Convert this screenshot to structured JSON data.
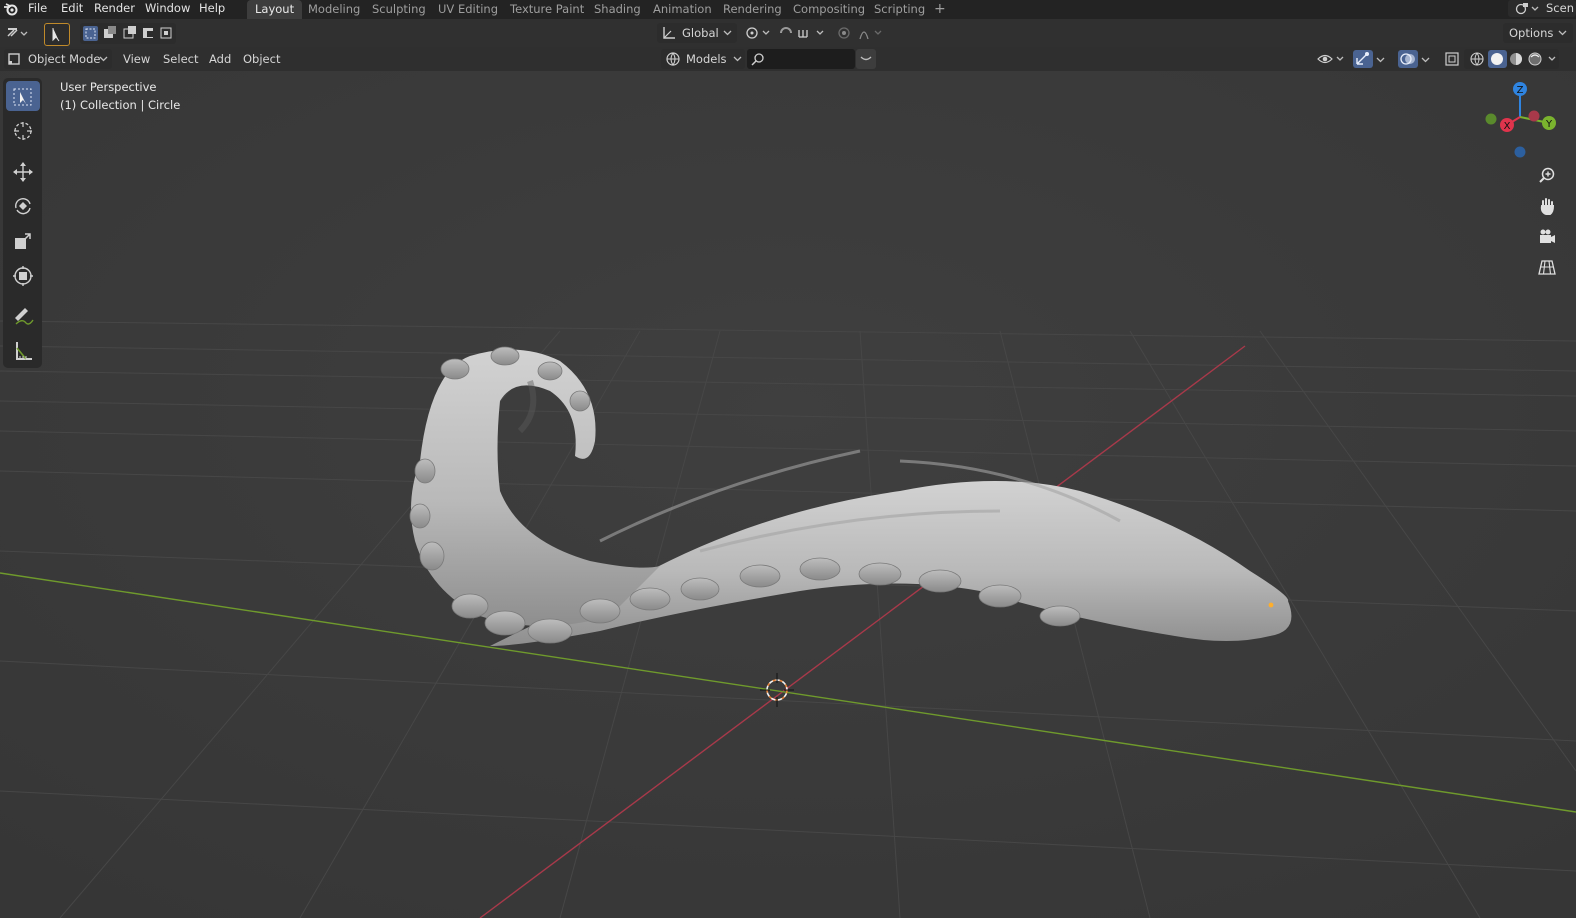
{
  "menu": {
    "items": [
      "File",
      "Edit",
      "Render",
      "Window",
      "Help"
    ]
  },
  "workspaces": {
    "tabs": [
      "Layout",
      "Modeling",
      "Sculpting",
      "UV Editing",
      "Texture Paint",
      "Shading",
      "Animation",
      "Rendering",
      "Compositing",
      "Scripting"
    ],
    "active": "Layout",
    "add_label": "+"
  },
  "scene": {
    "label": "Scen"
  },
  "toolbar": {
    "orientation_label": "Global",
    "options_label": "Options"
  },
  "header": {
    "mode_label": "Object Mode",
    "menus": [
      "View",
      "Select",
      "Add",
      "Object"
    ],
    "collection_filter": "Models",
    "search_value": ""
  },
  "viewport": {
    "view_name": "User Perspective",
    "collection_info": "(1) Collection | Circle"
  },
  "gizmo": {
    "x_label": "X",
    "y_label": "Y",
    "z_label": "Z",
    "x_color": "#e0344c",
    "y_color": "#7ab32e",
    "z_color": "#2f84e0"
  },
  "colors": {
    "active_tool": "#4a6391",
    "x_axis_line": "#a8394a",
    "y_axis_line": "#6f9a2c",
    "cursor": "#e8843a",
    "origin": "#ffae2a"
  },
  "icons": {
    "tools": [
      "select-box-icon",
      "cursor-icon",
      "move-icon",
      "rotate-icon",
      "scale-icon",
      "transform-icon",
      "annotate-icon",
      "measure-icon"
    ],
    "nav": [
      "zoom-icon",
      "hand-icon",
      "camera-icon",
      "grid-icon"
    ]
  }
}
